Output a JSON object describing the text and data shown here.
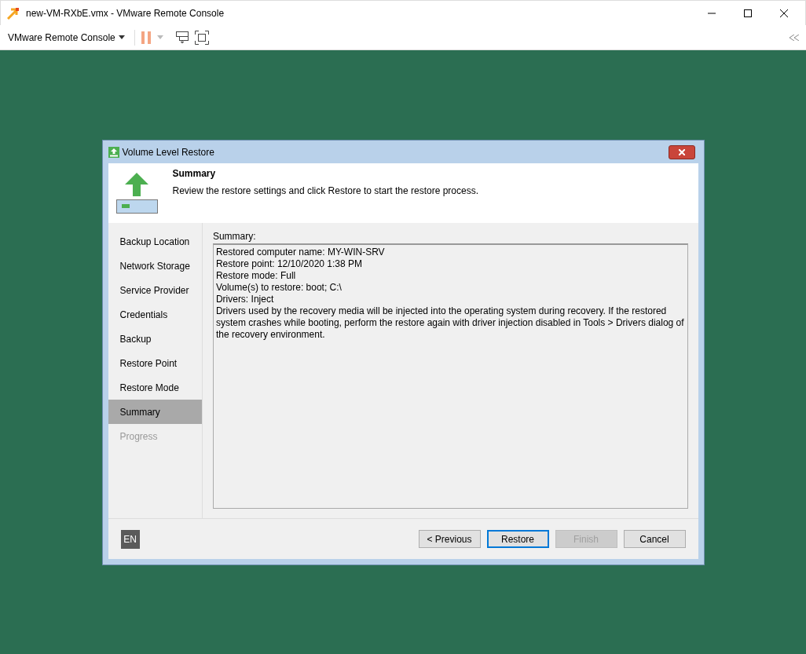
{
  "window": {
    "title": "new-VM-RXbE.vmx - VMware Remote Console"
  },
  "toolbar": {
    "menu_label": "VMware Remote Console"
  },
  "dialog": {
    "title": "Volume Level Restore",
    "heading": "Summary",
    "description": "Review the restore settings and click Restore to start the restore process.",
    "steps": [
      {
        "label": "Backup Location",
        "selected": false,
        "disabled": false
      },
      {
        "label": "Network Storage",
        "selected": false,
        "disabled": false
      },
      {
        "label": "Service Provider",
        "selected": false,
        "disabled": false
      },
      {
        "label": "Credentials",
        "selected": false,
        "disabled": false
      },
      {
        "label": "Backup",
        "selected": false,
        "disabled": false
      },
      {
        "label": "Restore Point",
        "selected": false,
        "disabled": false
      },
      {
        "label": "Restore Mode",
        "selected": false,
        "disabled": false
      },
      {
        "label": "Summary",
        "selected": true,
        "disabled": false
      },
      {
        "label": "Progress",
        "selected": false,
        "disabled": true
      }
    ],
    "summary_label": "Summary:",
    "summary_lines": [
      "Restored computer name: MY-WIN-SRV",
      "Restore point: 12/10/2020 1:38 PM",
      "Restore mode: Full",
      "Volume(s) to restore: boot; C:\\",
      "Drivers: Inject",
      "Drivers used by the recovery media will be injected into the operating system during recovery. If the restored system crashes while booting, perform the restore again with driver injection disabled in Tools > Drivers dialog of the recovery environment."
    ],
    "language": "EN",
    "buttons": [
      {
        "label": "< Previous",
        "default": false,
        "disabled": false
      },
      {
        "label": "Restore",
        "default": true,
        "disabled": false
      },
      {
        "label": "Finish",
        "default": false,
        "disabled": true
      },
      {
        "label": "Cancel",
        "default": false,
        "disabled": false
      }
    ]
  }
}
